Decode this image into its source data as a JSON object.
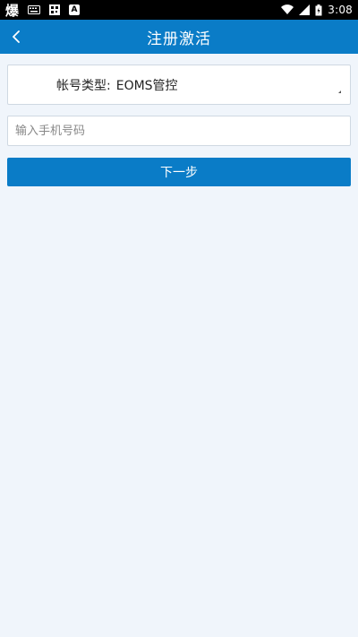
{
  "status_bar": {
    "left_icons": [
      "weather-app-icon",
      "keyboard-icon",
      "qr-app-icon",
      "a-app-icon"
    ],
    "left_glyph_text": "爆",
    "a_icon_text": "A",
    "time": "3:08",
    "right_icons": [
      "wifi-icon",
      "cellular-signal-icon",
      "battery-icon"
    ]
  },
  "app_bar": {
    "title": "注册激活",
    "background": "#0a7cc7"
  },
  "form": {
    "account_type_label": "帐号类型:",
    "account_type_value": "EOMS管控",
    "phone_placeholder": "输入手机号码",
    "phone_value": "",
    "next_label": "下一步"
  },
  "colors": {
    "accent": "#0a7cc7",
    "page_background": "#f0f5fb"
  }
}
